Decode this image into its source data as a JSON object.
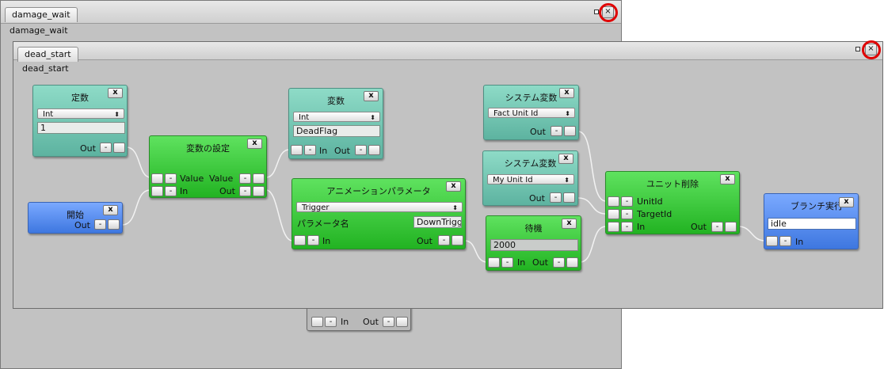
{
  "outer_window": {
    "tab": "damage_wait",
    "subtitle": "damage_wait",
    "close": "×"
  },
  "inner_window": {
    "tab": "dead_start",
    "subtitle": "dead_start",
    "close": "×"
  },
  "outer_node_fragment": {
    "in_label": "In",
    "out_label": "Out",
    "minus": "-"
  },
  "nodes": {
    "const": {
      "title": "定数",
      "x": "x",
      "type": "Int",
      "value": "1",
      "out": "Out",
      "minus": "-"
    },
    "start": {
      "title": "開始",
      "x": "x",
      "out": "Out",
      "minus": "-"
    },
    "set_var": {
      "title": "変数の設定",
      "x": "x",
      "value_in": "Value",
      "value_out": "Value",
      "in": "In",
      "out": "Out",
      "minus": "-"
    },
    "var": {
      "title": "変数",
      "x": "x",
      "type": "Int",
      "value": "DeadFlag",
      "in": "In",
      "out": "Out",
      "minus": "-"
    },
    "anim_param": {
      "title": "アニメーションパラメータ",
      "x": "x",
      "type": "Trigger",
      "param_label": "パラメータ名",
      "param_value": "DownTrigger",
      "in": "In",
      "out": "Out",
      "minus": "-"
    },
    "sysvar1": {
      "title": "システム変数",
      "x": "x",
      "type": "Fact Unit Id",
      "out": "Out",
      "minus": "-"
    },
    "sysvar2": {
      "title": "システム変数",
      "x": "x",
      "type": "My Unit Id",
      "out": "Out",
      "minus": "-"
    },
    "wait": {
      "title": "待機",
      "x": "x",
      "value": "2000",
      "in": "In",
      "out": "Out",
      "minus": "-"
    },
    "unit_delete": {
      "title": "ユニット削除",
      "x": "x",
      "unit_id": "UnitId",
      "target_id": "TargetId",
      "in": "In",
      "out": "Out",
      "minus": "-"
    },
    "branch": {
      "title": "ブランチ実行",
      "x": "x",
      "value": "idle",
      "in": "In",
      "minus": "-"
    }
  },
  "colors": {
    "teal": "#6fc6b2",
    "green": "#3ac93a",
    "blue": "#5a90f0",
    "highlight": "#e00000"
  }
}
